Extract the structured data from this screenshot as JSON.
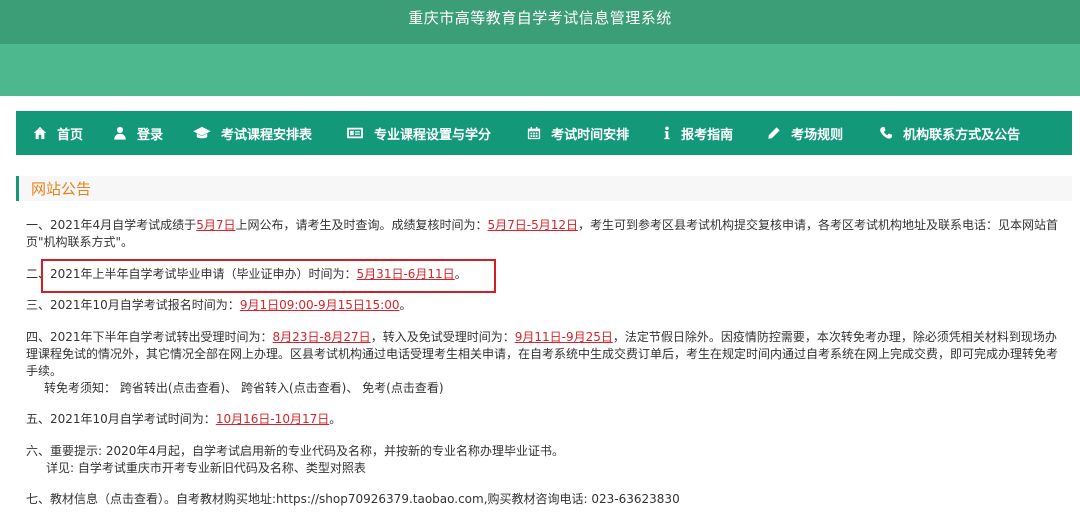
{
  "header": {
    "title": "重庆市高等教育自学考试信息管理系统"
  },
  "nav": [
    {
      "label": "首页",
      "icon": "home-icon"
    },
    {
      "label": "登录",
      "icon": "user-icon"
    },
    {
      "label": "考试课程安排表",
      "icon": "graduation-cap-icon"
    },
    {
      "label": "专业课程设置与学分",
      "icon": "id-card-icon"
    },
    {
      "label": "考试时间安排",
      "icon": "calendar-icon"
    },
    {
      "label": "报考指南",
      "icon": "info-icon"
    },
    {
      "label": "考场规则",
      "icon": "pencil-icon"
    },
    {
      "label": "机构联系方式及公告",
      "icon": "phone-icon"
    }
  ],
  "section": {
    "title": "网站公告"
  },
  "notices": {
    "n1": {
      "t1": "一、2021年4月自学考试成绩于",
      "l1": "5月7日",
      "t2": "上网公布，请考生及时查询。成绩复核时间为：",
      "l2": "5月7日-5月12日",
      "t3": "，考生可到参考区县考试机构提交复核申请，各考区考试机构地址及联系电话：见本网站首页\"机构联系方式\"。"
    },
    "n2": {
      "t1": "二、2021年上半年自学考试毕业申请（毕业证申办）时间为：",
      "l1": "5月31日-6月11日",
      "t2": "。"
    },
    "n3": {
      "t1": "三、2021年10月自学考试报名时间为：",
      "l1": "9月1日09:00-9月15日15:00",
      "t2": "。"
    },
    "n4": {
      "t1": "四、2021年下半年自学考试转出受理时间为：",
      "l1": "8月23日-8月27日",
      "t2": "，转入及免试受理时间为：",
      "l2": "9月11日-9月25日",
      "t3": "，法定节假日除外。因疫情防控需要，本次转免考办理，除必须凭相关材料到现场办理课程免试的情况外，其它情况全部在网上办理。区县考试机构通过电话受理考生相关申请，在自考系统中生成交费订单后，考生在规定时间内通过自考系统在网上完成交费，即可完成办理转免考手续。",
      "sub": "转免考须知：  跨省转出(点击查看)、  跨省转入(点击查看)、  免考(点击查看)"
    },
    "n5": {
      "t1": "五、2021年10月自学考试时间为：",
      "l1": "10月16日-10月17日",
      "t2": "。"
    },
    "n6": {
      "t1": "六、重要提示: 2020年4月起，自学考试启用新的专业代码及名称，并按新的专业名称办理毕业证书。",
      "sub": "详见: 自学考试重庆市开考专业新旧代码及名称、类型对照表"
    },
    "n7": {
      "t1": "七、教材信息（点击查看）。自考教材购买地址:https://shop70926379.taobao.com,购买教材咨询电话:  023-63623830"
    }
  },
  "colors": {
    "header": "#3c9e77",
    "banner": "#4db88e",
    "nav": "#13987a",
    "section_title": "#e8821a",
    "link": "#d9242b",
    "highlight_border": "#d21f26"
  }
}
